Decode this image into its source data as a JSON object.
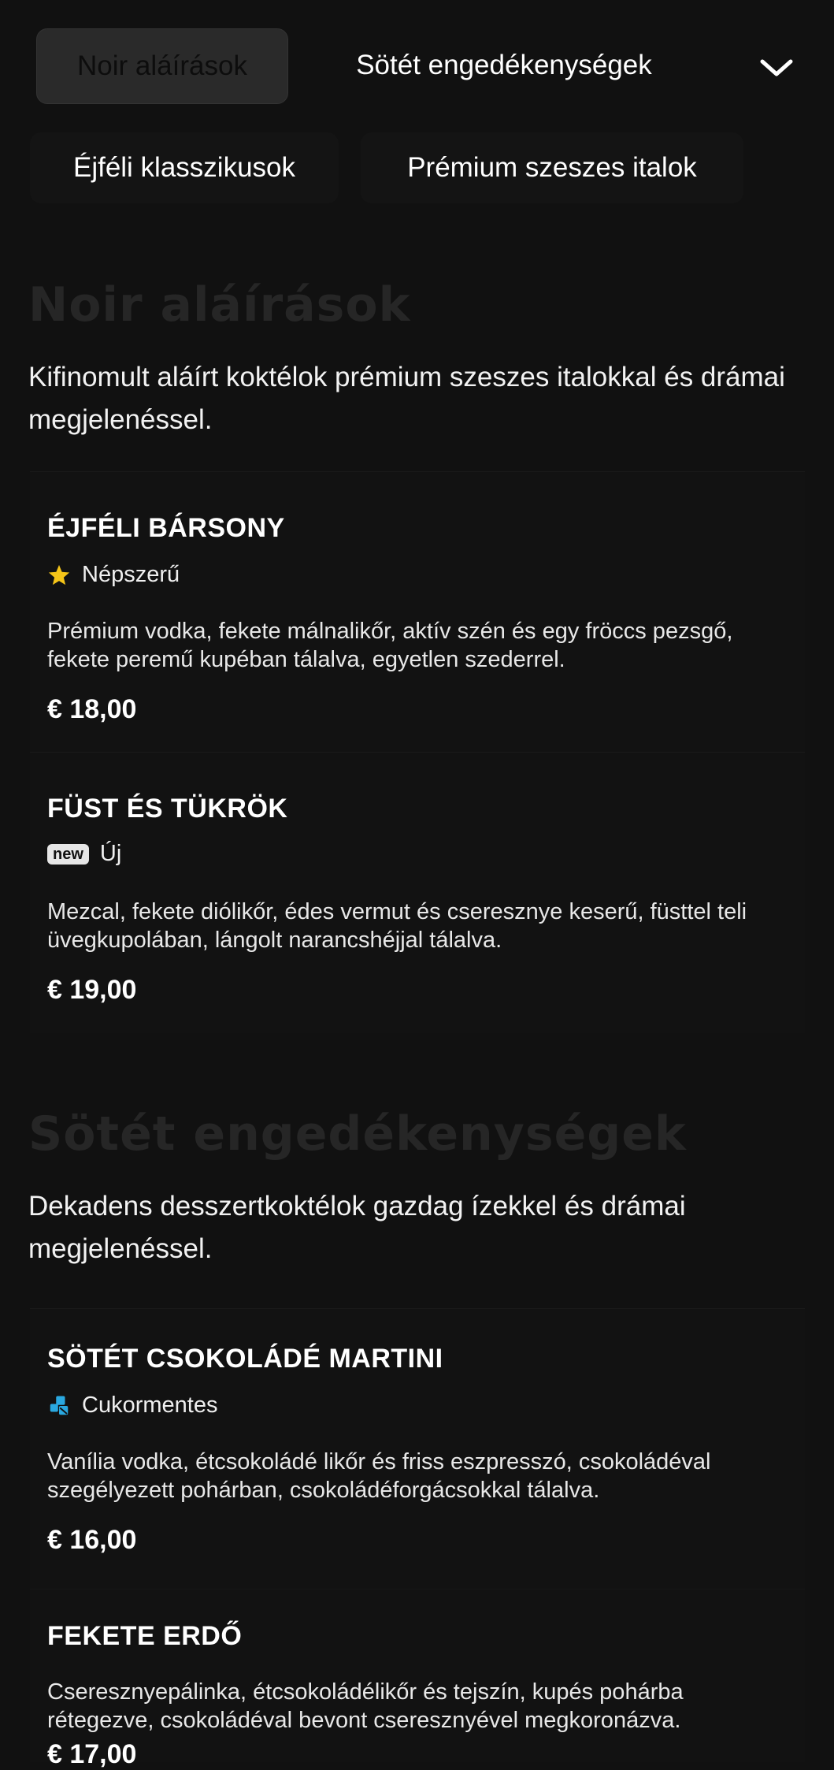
{
  "nav": {
    "tabs": [
      {
        "label": "Noir aláírások"
      },
      {
        "label": "Sötét engedékenységek"
      },
      {
        "label": "Éjféli klasszikusok"
      },
      {
        "label": "Prémium szeszes italok"
      }
    ],
    "expand_icon": "chevron-down-icon"
  },
  "sections": [
    {
      "title": "Noir aláírások",
      "description": "Kifinomult aláírt koktélok prémium szeszes italokkal és drámai megjelenéssel.",
      "items": [
        {
          "name": "ÉJFÉLI BÁRSONY",
          "badge_icon": "star-icon",
          "badge": "Népszerű",
          "description": "Prémium vodka, fekete málnalikőr, aktív szén és egy fröccs pezsgő, fekete peremű kupéban tálalva, egyetlen szederrel.",
          "price": "€ 18,00"
        },
        {
          "name": "FÜST ÉS TÜKRÖK",
          "badge_icon": "new-icon",
          "badge_pill": "new",
          "badge": "Új",
          "description": "Mezcal, fekete diólikőr, édes vermut és cseresznye keserű, füsttel teli üvegkupolában, lángolt narancshéjjal tálalva.",
          "price": "€ 19,00"
        }
      ]
    },
    {
      "title": "Sötét engedékenységek",
      "description": "Dekadens desszertkoktélok gazdag ízekkel és drámai megjelenéssel.",
      "items": [
        {
          "name": "SÖTÉT CSOKOLÁDÉ MARTINI",
          "badge_icon": "sugar-free-icon",
          "badge": "Cukormentes",
          "description": "Vanília vodka, étcsokoládé likőr és friss eszpresszó, csokoládéval szegélyezett pohárban, csokoládéforgácsokkal tálalva.",
          "price": "€ 16,00"
        },
        {
          "name": "FEKETE ERDŐ",
          "description": "Cseresznyepálinka, étcsokoládélikőr és tejszín, kupés pohárba rétegezve, csokoládéval bevont cseresznyével megkoronázva.",
          "price": "€ 17,00"
        }
      ]
    }
  ],
  "colors": {
    "background": "#111111",
    "star": "#f5c518",
    "sugar_free": "#2aa8e0",
    "title_muted": "#262626"
  }
}
